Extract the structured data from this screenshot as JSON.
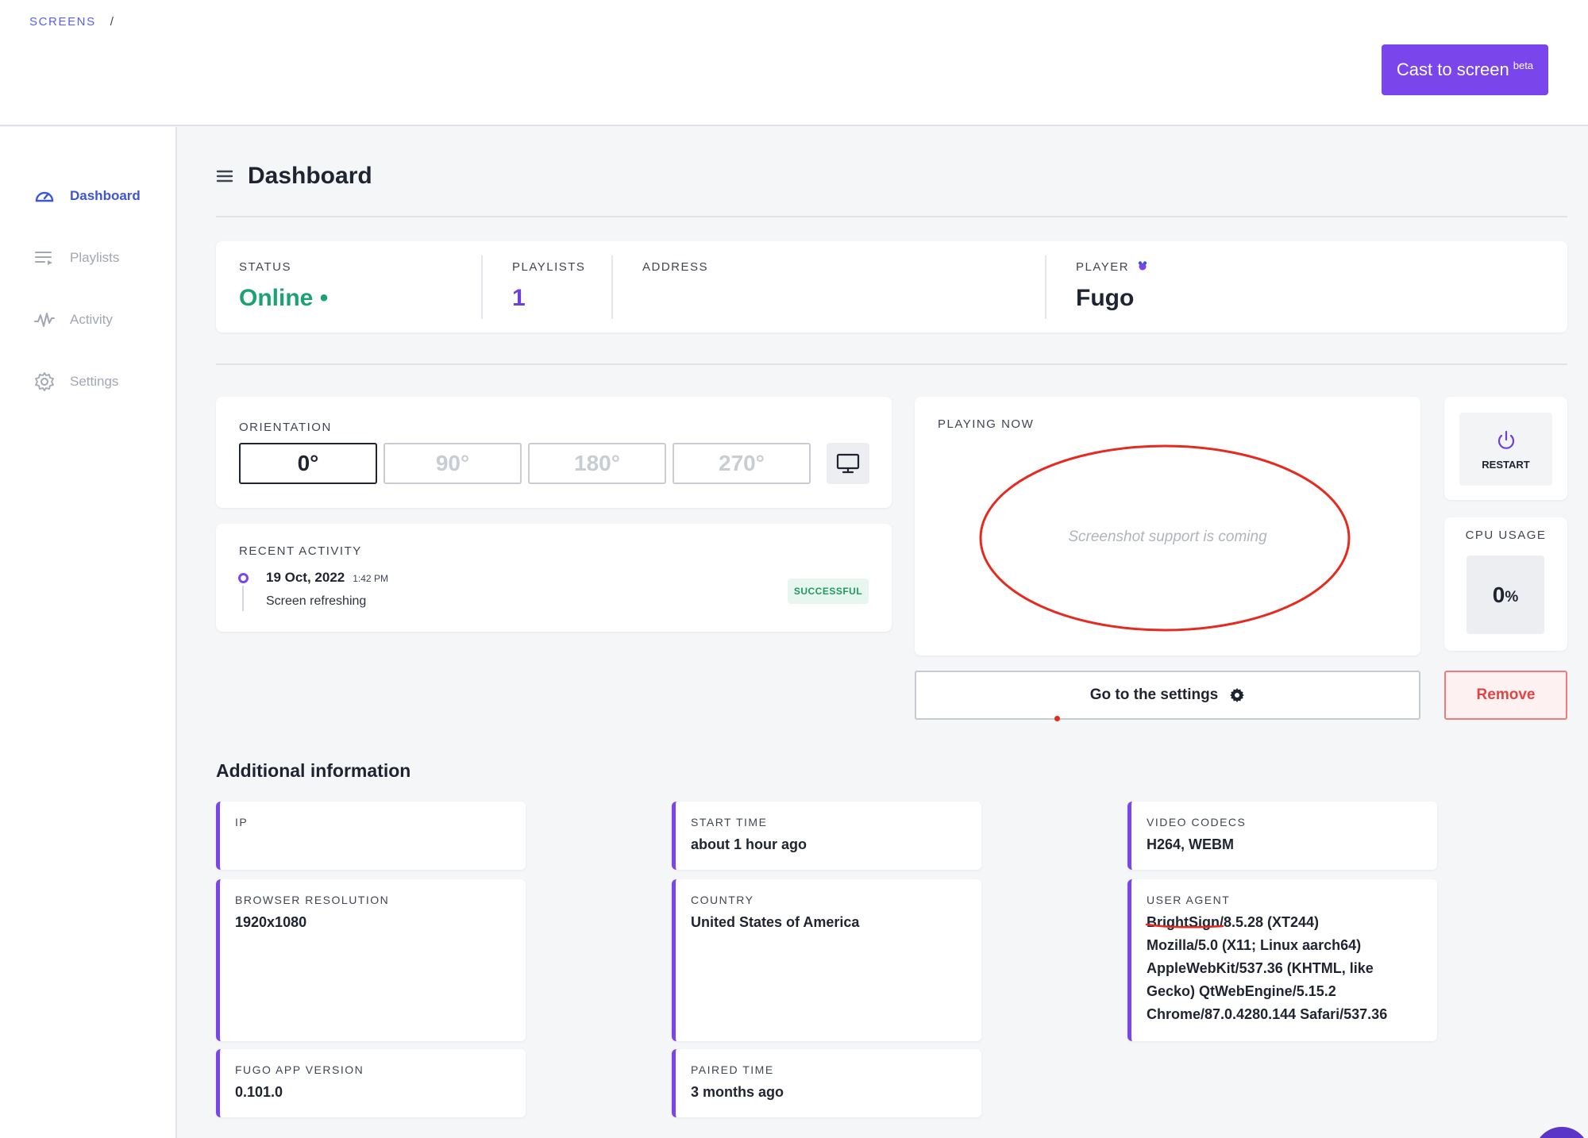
{
  "breadcrumb": {
    "root": "SCREENS",
    "separator": "/"
  },
  "header": {
    "cast_label": "Cast to screen",
    "cast_badge": "beta"
  },
  "sidebar": {
    "items": [
      {
        "label": "Dashboard",
        "icon": "dashboard-icon",
        "active": true
      },
      {
        "label": "Playlists",
        "icon": "playlist-icon",
        "active": false
      },
      {
        "label": "Activity",
        "icon": "activity-icon",
        "active": false
      },
      {
        "label": "Settings",
        "icon": "gear-icon",
        "active": false
      }
    ]
  },
  "page": {
    "title": "Dashboard",
    "menu_icon": "hamburger-icon"
  },
  "status": {
    "status_label": "STATUS",
    "status_value": "Online",
    "status_dot": "•",
    "playlists_label": "PLAYLISTS",
    "playlists_value": "1",
    "address_label": "ADDRESS",
    "address_value": "",
    "player_label": "PLAYER",
    "player_icon": "fugo-icon",
    "player_value": "Fugo"
  },
  "orientation": {
    "label": "ORIENTATION",
    "options": [
      "0°",
      "90°",
      "180°",
      "270°"
    ],
    "selected": "0°",
    "monitor_icon": "monitor-icon"
  },
  "recent_activity": {
    "label": "RECENT ACTIVITY",
    "date": "19 Oct, 2022",
    "time": "1:42 PM",
    "description": "Screen refreshing",
    "status": "SUCCESSFUL"
  },
  "playing_now": {
    "label": "PLAYING NOW",
    "placeholder": "Screenshot support is coming"
  },
  "restart": {
    "label": "RESTART",
    "icon": "power-icon"
  },
  "cpu": {
    "label": "CPU USAGE",
    "value": "0",
    "unit": "%"
  },
  "actions": {
    "settings_label": "Go to the settings",
    "settings_icon": "gear-icon",
    "remove_label": "Remove"
  },
  "additional": {
    "title": "Additional information",
    "ip": {
      "label": "IP",
      "value": ""
    },
    "browser_resolution": {
      "label": "BROWSER RESOLUTION",
      "value": "1920x1080"
    },
    "app_version": {
      "label": "FUGO APP VERSION",
      "value": "0.101.0"
    },
    "start_time": {
      "label": "START TIME",
      "value": "about 1 hour ago"
    },
    "country": {
      "label": "COUNTRY",
      "value": "United States of America"
    },
    "paired_time": {
      "label": "PAIRED TIME",
      "value": "3 months ago"
    },
    "video_codecs": {
      "label": "VIDEO CODECS",
      "value": "H264, WEBM"
    },
    "user_agent": {
      "label": "USER AGENT",
      "lines": [
        "BrightSign/8.5.28 (XT244)",
        "Mozilla/5.0 (X11; Linux aarch64)",
        "AppleWebKit/537.36 (KHTML, like",
        "Gecko) QtWebEngine/5.15.2",
        "Chrome/87.0.4280.144 Safari/537.36"
      ]
    }
  },
  "colors": {
    "accent": "#7a45ea",
    "nav_active": "#3e55d6",
    "online": "#1aa271",
    "danger": "#e24444",
    "annotation": "#e52b1f"
  }
}
